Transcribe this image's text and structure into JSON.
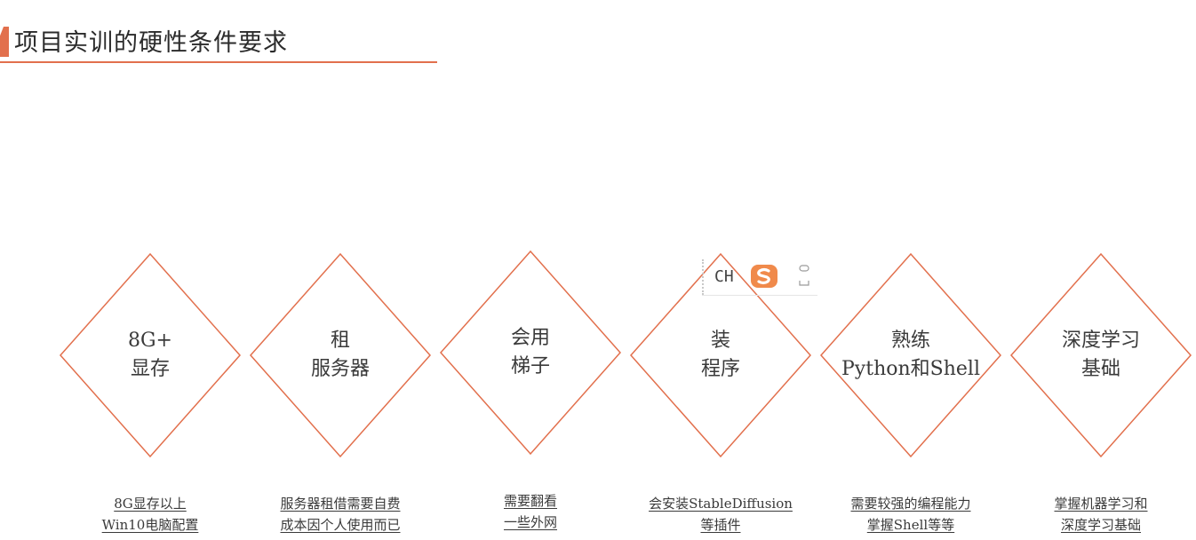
{
  "title": "项目实训的硬性条件要求",
  "accent_color": "#e2704d",
  "items": [
    {
      "line1": "8G+",
      "line2": "显存",
      "caption1": "8G显存以上",
      "caption2": "Win10电脑配置"
    },
    {
      "line1": "租",
      "line2": "服务器",
      "caption1": "服务器租借需要自费",
      "caption2": "成本因个人使用而已"
    },
    {
      "line1": "会用",
      "line2": "梯子",
      "caption1": "需要翻看",
      "caption2": "一些外网"
    },
    {
      "line1": "装",
      "line2": "程序",
      "caption1": "会安装StableDiffusion",
      "caption2": "等插件"
    },
    {
      "line1": "熟练",
      "line2": "Python和Shell",
      "caption1": "需要较强的编程能力",
      "caption2": "掌握Shell等等"
    },
    {
      "line1": "深度学习",
      "line2": "基础",
      "caption1": "掌握机器学习和",
      "caption2": "深度学习基础"
    }
  ],
  "ime_toolbar": {
    "mode_label": "CH",
    "logo_icon": "sogou-s-icon",
    "menu_icon": "more-dots-icon"
  }
}
